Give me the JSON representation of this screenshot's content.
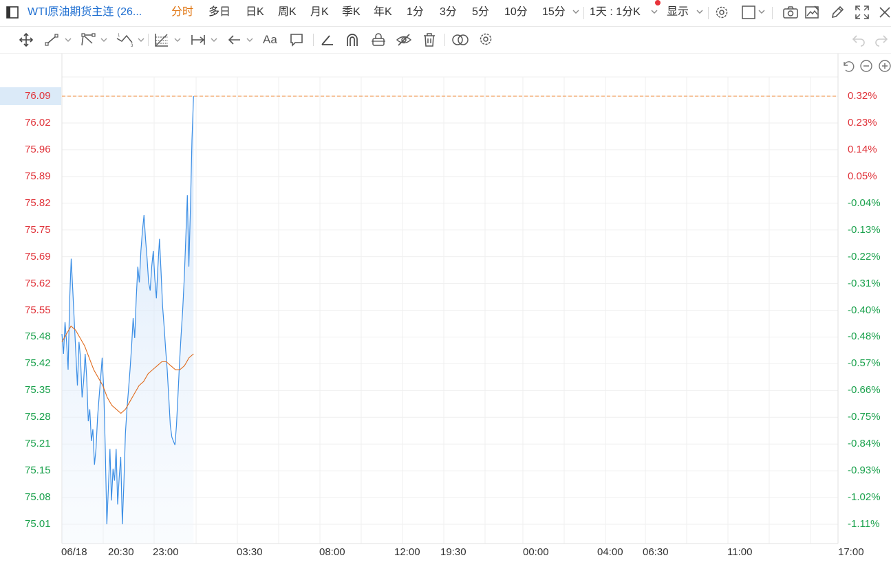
{
  "toolbar": {
    "title": "WTI原油期货主连 (26...",
    "periods": [
      {
        "label": "分时",
        "active": true
      },
      {
        "label": "多日",
        "active": false
      },
      {
        "label": "日K",
        "active": false
      },
      {
        "label": "周K",
        "active": false
      },
      {
        "label": "月K",
        "active": false
      },
      {
        "label": "季K",
        "active": false
      },
      {
        "label": "年K",
        "active": false
      },
      {
        "label": "1分",
        "active": false
      },
      {
        "label": "3分",
        "active": false
      },
      {
        "label": "5分",
        "active": false
      },
      {
        "label": "10分",
        "active": false
      },
      {
        "label": "15分",
        "active": false
      }
    ],
    "interval_label": "1天 : 1分K",
    "display_label": "显示",
    "font_label": "Aa"
  },
  "colors": {
    "price_line": "#3b8ee5",
    "avg_line": "#e06b1d",
    "up": "#e0333a",
    "down": "#1aa14c",
    "title": "#1f6fd1",
    "active_tab": "#e0740f",
    "highlight": "#dbeaf8"
  },
  "chart_data": {
    "type": "line",
    "x_ticks": [
      "06/18",
      "20:30",
      "23:00",
      "03:30",
      "08:00",
      "12:00",
      "19:30",
      "00:00",
      "04:00",
      "06:30",
      "11:00",
      "17:00"
    ],
    "y_ticks": [
      "76.09",
      "76.02",
      "75.96",
      "75.89",
      "75.82",
      "75.75",
      "75.69",
      "75.62",
      "75.55",
      "75.48",
      "75.42",
      "75.35",
      "75.28",
      "75.21",
      "75.15",
      "75.08",
      "75.01"
    ],
    "y_right_ticks": [
      "0.32%",
      "0.23%",
      "0.14%",
      "0.05%",
      "-0.04%",
      "-0.13%",
      "-0.22%",
      "-0.31%",
      "-0.40%",
      "-0.48%",
      "-0.57%",
      "-0.66%",
      "-0.75%",
      "-0.84%",
      "-0.93%",
      "-1.02%",
      "-1.11%"
    ],
    "ylim": [
      75.01,
      76.09
    ],
    "current_price": "76.09",
    "current_pct": "0.32%",
    "grid": true,
    "series": [
      {
        "values": [
          75.49,
          75.44,
          75.52,
          75.47,
          75.4,
          75.58,
          75.68,
          75.6,
          75.52,
          75.44,
          75.36,
          75.47,
          75.43,
          75.33,
          75.37,
          75.44,
          75.38,
          75.27,
          75.3,
          75.22,
          75.25,
          75.16,
          75.2,
          75.28,
          75.33,
          75.38,
          75.43,
          75.35,
          75.2,
          75.01,
          75.1,
          75.2,
          75.07,
          75.15,
          75.12,
          75.2,
          75.06,
          75.13,
          75.18,
          75.01,
          75.11,
          75.24,
          75.3,
          75.35,
          75.4,
          75.46,
          75.53,
          75.48,
          75.58,
          75.66,
          75.62,
          75.7,
          75.75,
          75.79,
          75.73,
          75.68,
          75.62,
          75.6,
          75.66,
          75.7,
          75.63,
          75.58,
          75.66,
          75.73,
          75.65,
          75.56,
          75.51,
          75.45,
          75.4,
          75.33,
          75.26,
          75.23,
          75.22,
          75.21,
          75.26,
          75.34,
          75.42,
          75.49,
          75.55,
          75.63,
          75.73,
          75.84,
          75.66,
          75.81,
          75.98,
          76.09
        ]
      },
      {
        "values": [
          75.47,
          75.49,
          75.51,
          75.5,
          75.48,
          75.46,
          75.43,
          75.4,
          75.38,
          75.36,
          75.33,
          75.31,
          75.3,
          75.29,
          75.3,
          75.32,
          75.34,
          75.36,
          75.37,
          75.39,
          75.4,
          75.41,
          75.42,
          75.42,
          75.41,
          75.4,
          75.4,
          75.41,
          75.43,
          75.44
        ]
      }
    ]
  }
}
